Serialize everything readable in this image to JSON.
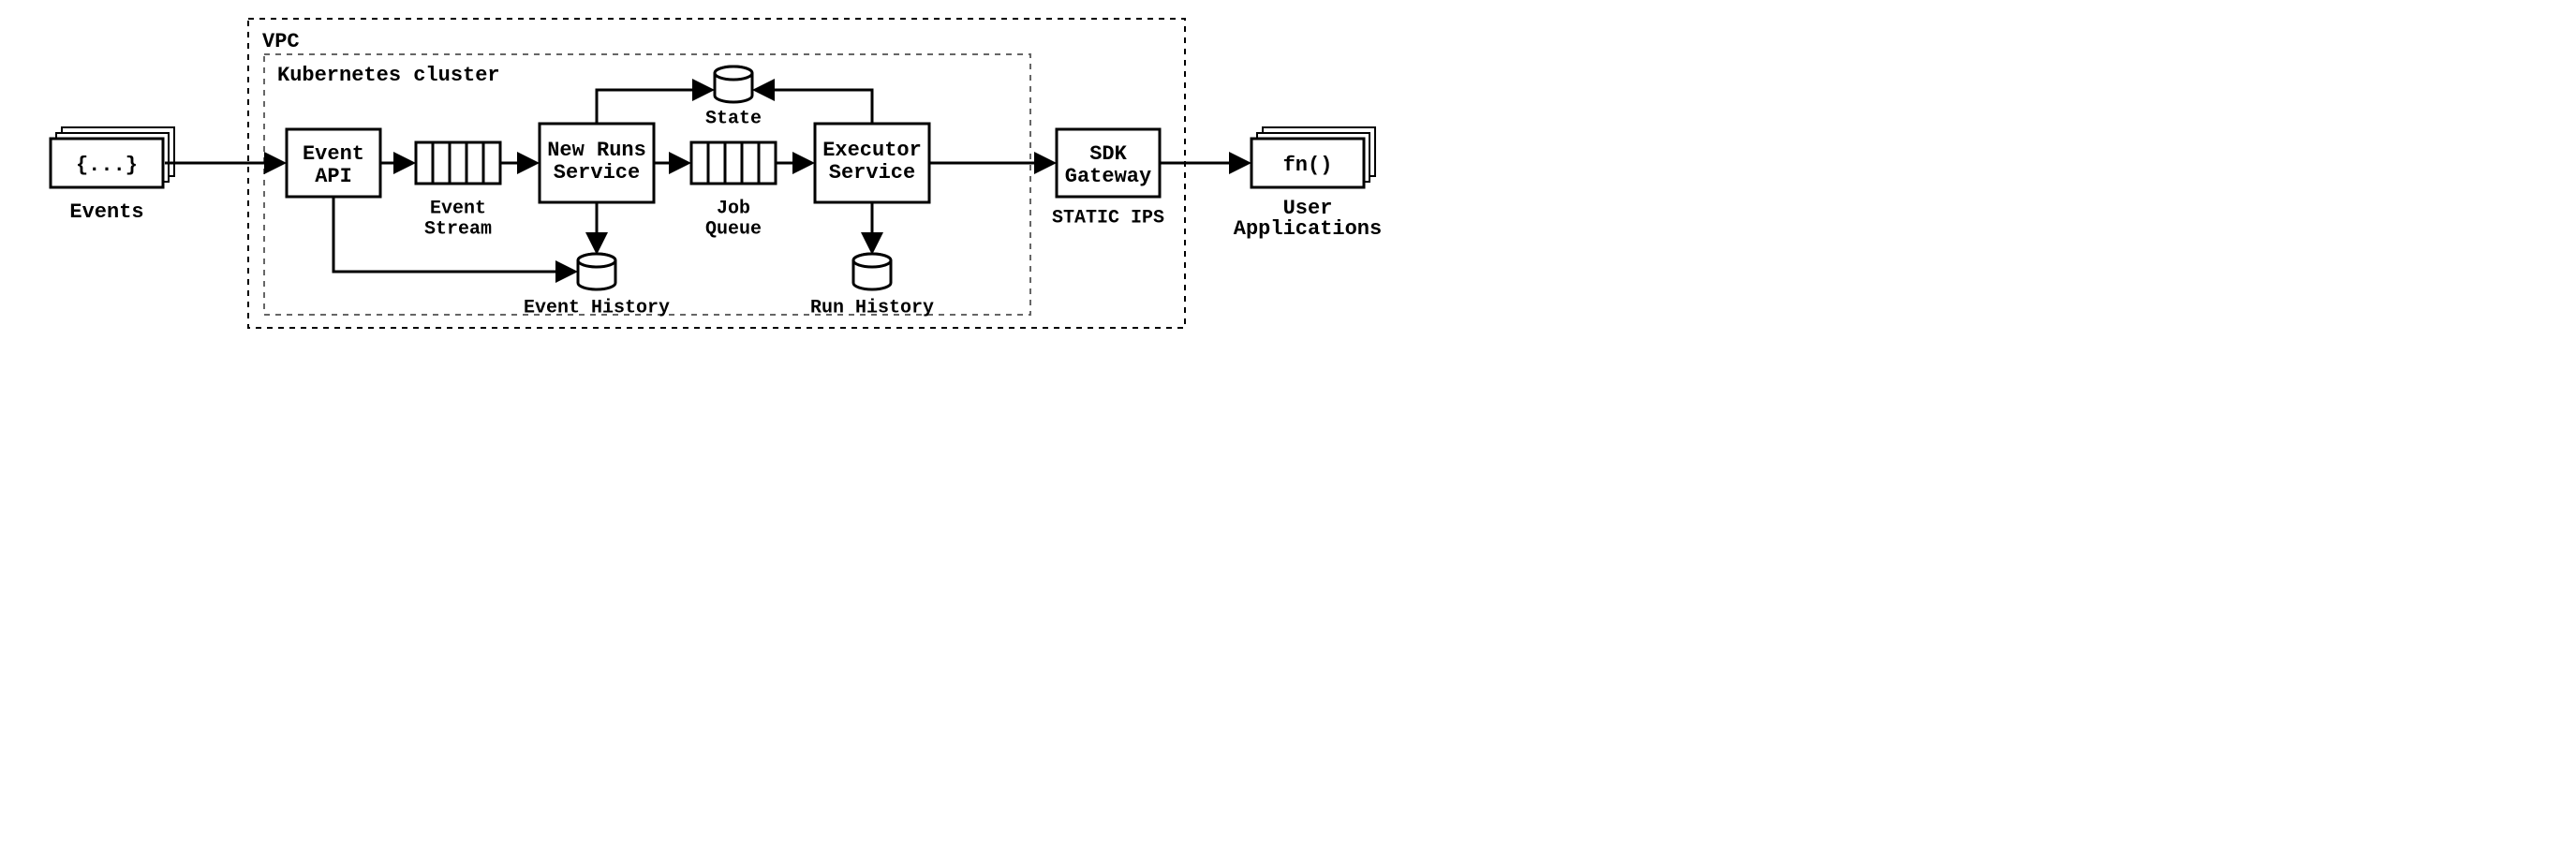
{
  "containers": {
    "vpc": "VPC",
    "k8s": "Kubernetes cluster"
  },
  "nodes": {
    "events_content": "{...}",
    "events_label": "Events",
    "event_api": "Event API",
    "event_stream": "Event Stream",
    "new_runs": "New Runs Service",
    "job_queue": "Job Queue",
    "executor": "Executor Service",
    "state": "State",
    "event_history": "Event History",
    "run_history": "Run History",
    "sdk_gateway": "SDK Gateway",
    "static_ips": "STATIC IPS",
    "user_apps_content": "fn()",
    "user_apps_label1": "User",
    "user_apps_label2": "Applications"
  }
}
